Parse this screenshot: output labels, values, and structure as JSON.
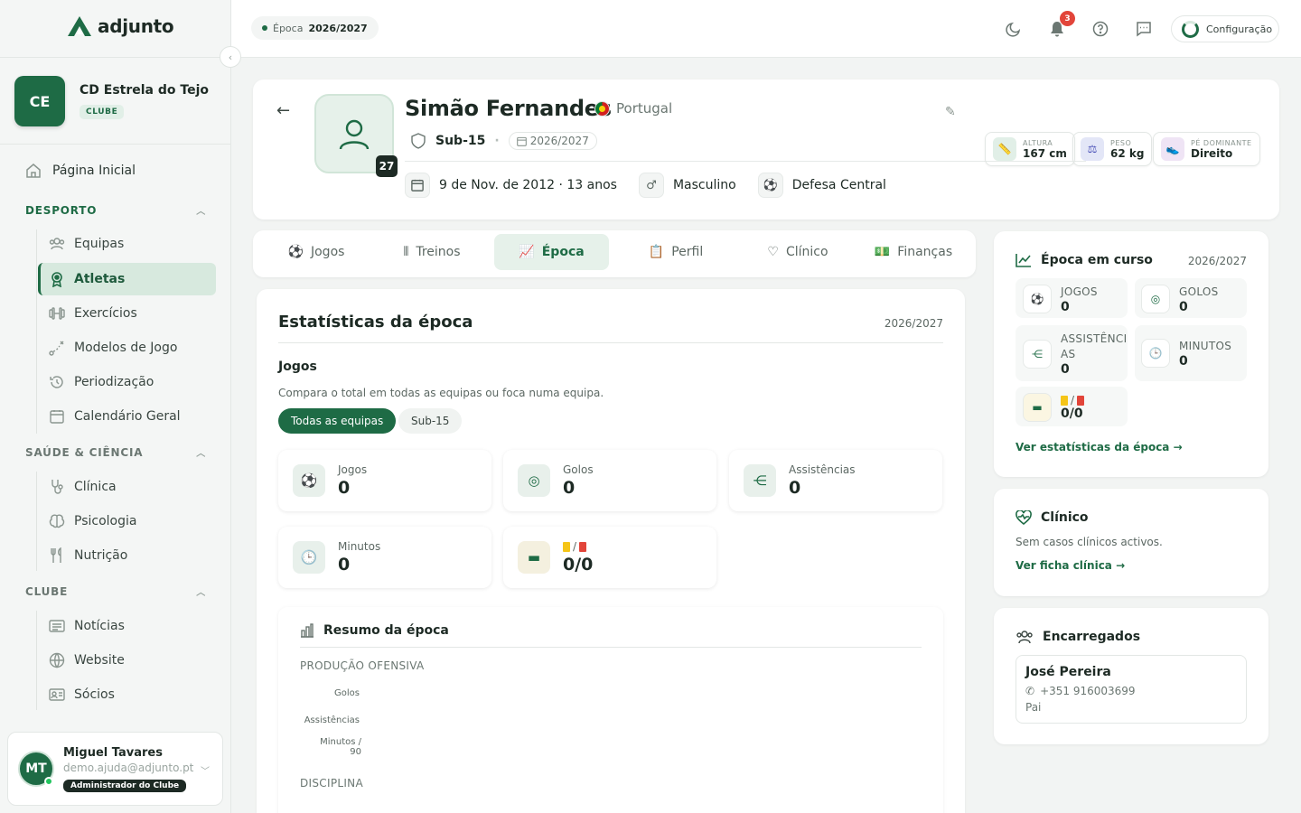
{
  "app": {
    "name": "adjunto"
  },
  "club": {
    "initials": "CE",
    "name": "CD Estrela do Tejo",
    "badge": "CLUBE"
  },
  "nav": {
    "home": "Página Inicial",
    "sections": [
      {
        "title": "DESPORTO",
        "items": [
          "Equipas",
          "Atletas",
          "Exercícios",
          "Modelos de Jogo",
          "Periodização",
          "Calendário Geral"
        ]
      },
      {
        "title": "SAÚDE & CIÊNCIA",
        "items": [
          "Clínica",
          "Psicologia",
          "Nutrição"
        ]
      },
      {
        "title": "CLUBE",
        "items": [
          "Notícias",
          "Website",
          "Sócios"
        ]
      }
    ],
    "active_item": "Atletas"
  },
  "user": {
    "initials": "MT",
    "name": "Miguel Tavares",
    "email": "demo.ajuda@adjunto.pt",
    "role": "Administrador do Clube"
  },
  "topbar": {
    "season_label": "Época",
    "season_value": "2026/2027",
    "notifications": "3",
    "config_label": "Configuração"
  },
  "player": {
    "name": "Simão Fernandes",
    "country": "Portugal",
    "number": "27",
    "team": "Sub-15",
    "season": "2026/2027",
    "birth": "9 de Nov. de 2012 · 13 anos",
    "gender": "Masculino",
    "position": "Defesa Central",
    "attributes": [
      {
        "label": "ALTURA",
        "value": "167 cm"
      },
      {
        "label": "PESO",
        "value": "62 kg"
      },
      {
        "label": "PÉ DOMINANTE",
        "value": "Direito"
      }
    ]
  },
  "tabs": [
    "Jogos",
    "Treinos",
    "Época",
    "Perfil",
    "Clínico",
    "Finanças"
  ],
  "active_tab": "Época",
  "stats": {
    "title": "Estatísticas da época",
    "season": "2026/2027",
    "section": "Jogos",
    "description": "Compara o total em todas as equipas ou foca numa equipa.",
    "filters": [
      "Todas as equipas",
      "Sub-15"
    ],
    "tiles": [
      {
        "label": "Jogos",
        "value": "0"
      },
      {
        "label": "Golos",
        "value": "0"
      },
      {
        "label": "Assistências",
        "value": "0"
      },
      {
        "label": "Minutos",
        "value": "0"
      },
      {
        "label": "/",
        "value": "0/0"
      }
    ],
    "summary": {
      "title": "Resumo da época",
      "offensive": "PRODUÇÃO OFENSIVA",
      "rows": [
        "Golos",
        "Assistências",
        "Minutos / 90"
      ],
      "discipline": "DISCIPLINA"
    }
  },
  "season_card": {
    "title": "Época em curso",
    "season": "2026/2027",
    "items": [
      {
        "label": "JOGOS",
        "value": "0"
      },
      {
        "label": "GOLOS",
        "value": "0"
      },
      {
        "label": "ASSISTÊNCI AS",
        "value": "0"
      },
      {
        "label": "MINUTOS",
        "value": "0"
      },
      {
        "label": "/",
        "value": "0/0"
      }
    ],
    "link": "Ver estatísticas da época →"
  },
  "clinical_card": {
    "title": "Clínico",
    "text": "Sem casos clínicos activos.",
    "link": "Ver ficha clínica →"
  },
  "guardians_card": {
    "title": "Encarregados",
    "name": "José Pereira",
    "phone": "+351 916003699",
    "relation": "Pai"
  }
}
